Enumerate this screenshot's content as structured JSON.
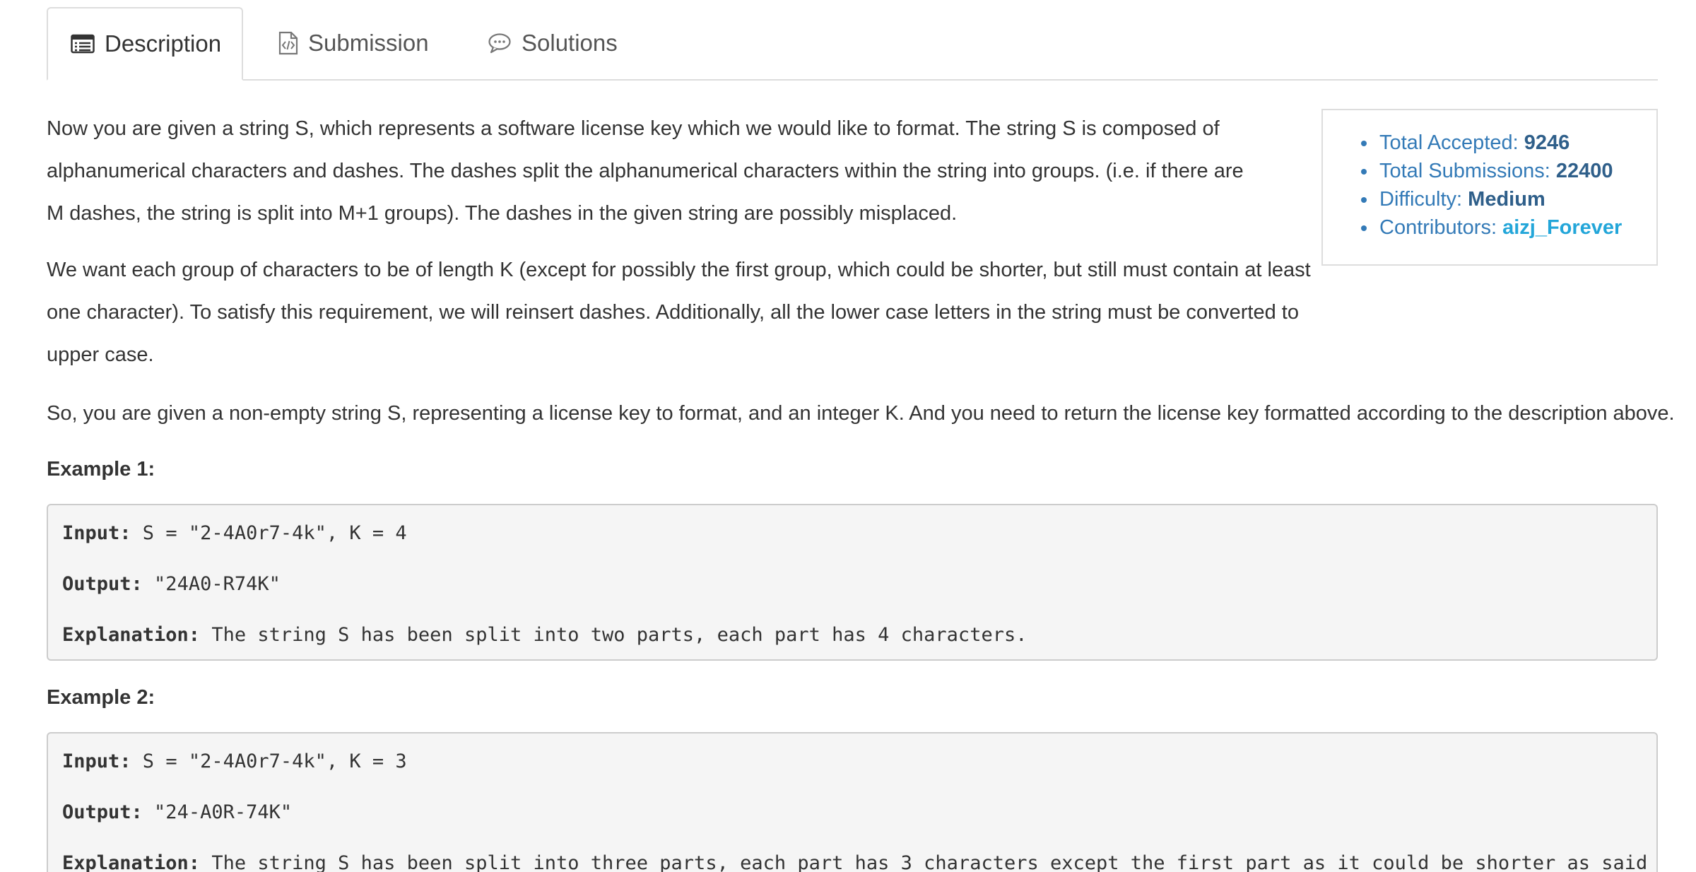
{
  "tabs": [
    {
      "label": "Description",
      "icon": "description-icon",
      "active": true
    },
    {
      "label": "Submission",
      "icon": "submission-icon",
      "active": false
    },
    {
      "label": "Solutions",
      "icon": "solutions-icon",
      "active": false
    }
  ],
  "stats": {
    "accepted_label": "Total Accepted:",
    "accepted_value": "9246",
    "submissions_label": "Total Submissions:",
    "submissions_value": "22400",
    "difficulty_label": "Difficulty:",
    "difficulty_value": "Medium",
    "contributors_label": "Contributors:",
    "contributors_value": "aizj_Forever"
  },
  "description": {
    "p1": "Now you are given a string S, which represents a software license key which we would like to format. The string S is composed of alphanumerical characters and dashes. The dashes split the alphanumerical characters within the string into groups. (i.e. if there are M dashes, the string is split into M+1 groups). The dashes in the given string are possibly misplaced.",
    "p2": "We want each group of characters to be of length K (except for possibly the first group, which could be shorter, but still must contain at least one character). To satisfy this requirement, we will reinsert dashes. Additionally, all the lower case letters in the string must be converted to upper case.",
    "p3": "So, you are given a non-empty string S, representing a license key to format, and an integer K. And you need to return the license key formatted according to the description above."
  },
  "examples": [
    {
      "title": "Example 1:",
      "input_label": "Input:",
      "input_value": " S = \"2-4A0r7-4k\", K = 4",
      "output_label": "Output:",
      "output_value": " \"24A0-R74K\"",
      "explanation_label": "Explanation:",
      "explanation_value": " The string S has been split into two parts, each part has 4 characters."
    },
    {
      "title": "Example 2:",
      "input_label": "Input:",
      "input_value": " S = \"2-4A0r7-4k\", K = 3",
      "output_label": "Output:",
      "output_value": " \"24-A0R-74K\"",
      "explanation_label": "Explanation:",
      "explanation_value": " The string S has been split into three parts, each part has 3 characters except the first part as it could be shorter as said above."
    }
  ]
}
